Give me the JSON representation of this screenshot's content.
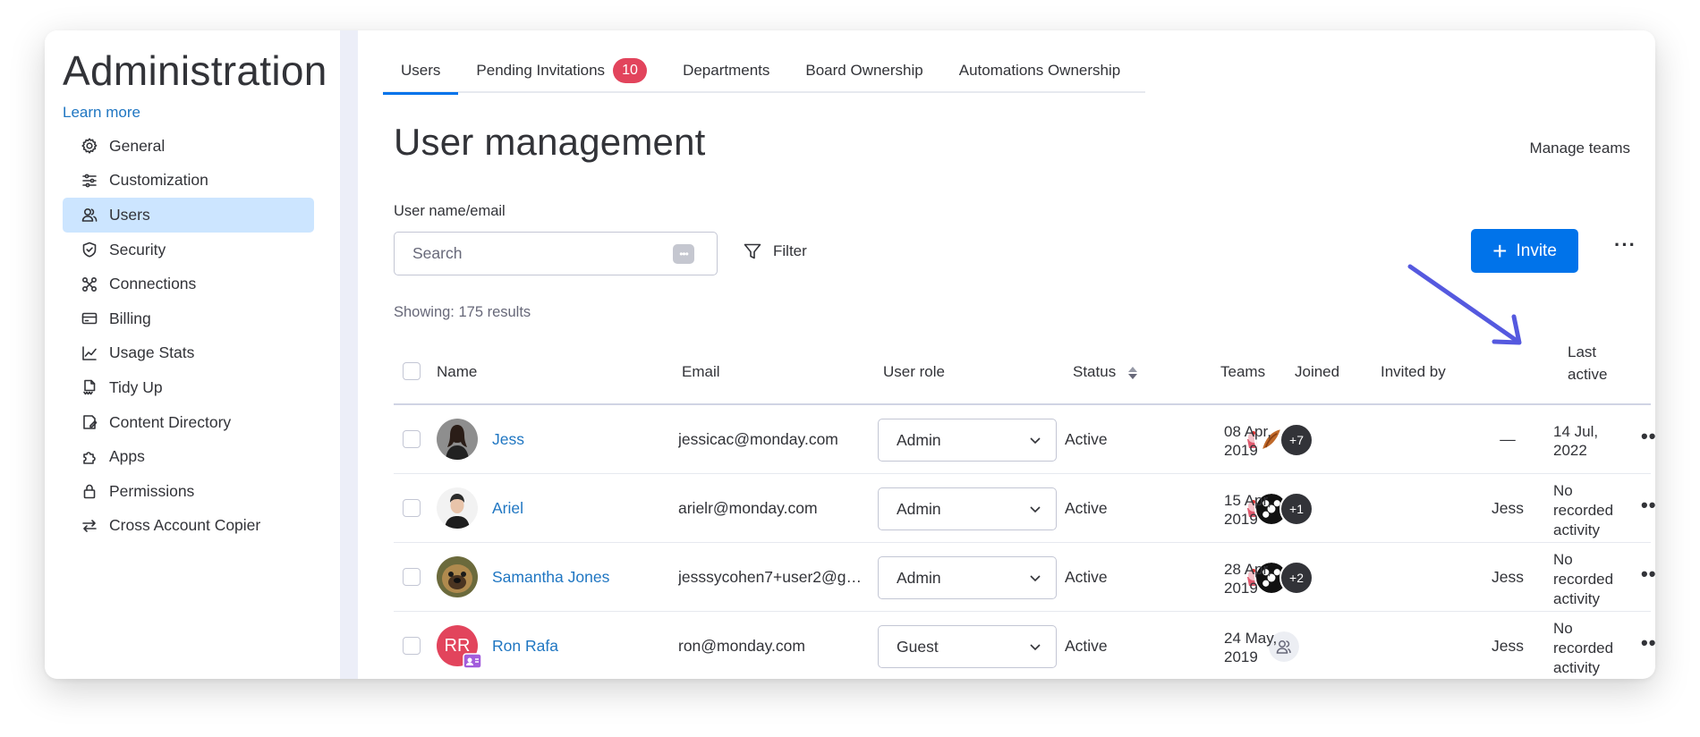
{
  "sidebar": {
    "title": "Administration",
    "learn_more": "Learn more",
    "items": [
      {
        "label": "General",
        "icon": "gear-icon"
      },
      {
        "label": "Customization",
        "icon": "sliders-icon"
      },
      {
        "label": "Users",
        "icon": "users-icon",
        "active": true
      },
      {
        "label": "Security",
        "icon": "shield-icon"
      },
      {
        "label": "Connections",
        "icon": "connections-icon"
      },
      {
        "label": "Billing",
        "icon": "credit-card-icon"
      },
      {
        "label": "Usage Stats",
        "icon": "line-chart-icon"
      },
      {
        "label": "Tidy Up",
        "icon": "tidy-up-icon"
      },
      {
        "label": "Content Directory",
        "icon": "content-directory-icon"
      },
      {
        "label": "Apps",
        "icon": "puzzle-icon"
      },
      {
        "label": "Permissions",
        "icon": "lock-icon"
      },
      {
        "label": "Cross Account Copier",
        "icon": "arrows-swap-icon"
      }
    ]
  },
  "tabs": [
    {
      "label": "Users",
      "active": true
    },
    {
      "label": "Pending Invitations",
      "badge": "10"
    },
    {
      "label": "Departments"
    },
    {
      "label": "Board Ownership"
    },
    {
      "label": "Automations Ownership"
    }
  ],
  "main": {
    "title": "User management",
    "manage_teams": "Manage teams",
    "search_label": "User name/email",
    "search_placeholder": "Search",
    "filter_label": "Filter",
    "invite_label": "Invite",
    "showing": "Showing: 175 results"
  },
  "table": {
    "headers": {
      "name": "Name",
      "email": "Email",
      "role": "User role",
      "status": "Status",
      "teams": "Teams",
      "joined": "Joined",
      "invited_by": "Invited by",
      "last_active_1": "Last",
      "last_active_2": "active"
    },
    "rows": [
      {
        "name": "Jess",
        "email": "jessicac@monday.com",
        "role": "Admin",
        "status": "Active",
        "teams_more": "+7",
        "joined_1": "08 Apr,",
        "joined_2": "2019",
        "invited_by": "—",
        "last_1": "",
        "last_2": "14 Jul,",
        "last_3": "2022"
      },
      {
        "name": "Ariel",
        "email": "arielr@monday.com",
        "role": "Admin",
        "status": "Active",
        "teams_more": "+1",
        "joined_1": "15 Apr,",
        "joined_2": "2019",
        "invited_by": "Jess",
        "last_1": "No",
        "last_2": "recorded",
        "last_3": "activity"
      },
      {
        "name": "Samantha Jones",
        "email": "jesssycohen7+user2@gm...",
        "role": "Admin",
        "status": "Active",
        "teams_more": "+2",
        "joined_1": "28 Apr,",
        "joined_2": "2019",
        "invited_by": "Jess",
        "last_1": "No",
        "last_2": "recorded",
        "last_3": "activity"
      },
      {
        "name": "Ron Rafa",
        "email": "ron@monday.com",
        "role": "Guest",
        "status": "Active",
        "initials": "RR",
        "joined_1": "24 May,",
        "joined_2": "2019",
        "invited_by": "Jess",
        "last_1": "No",
        "last_2": "recorded",
        "last_3": "activity"
      }
    ]
  },
  "colors": {
    "accent": "#0073ea",
    "link": "#1f76c2",
    "badge": "#e2445c",
    "sidebar_active": "#cce5ff",
    "annotation_arrow": "#5559df"
  }
}
